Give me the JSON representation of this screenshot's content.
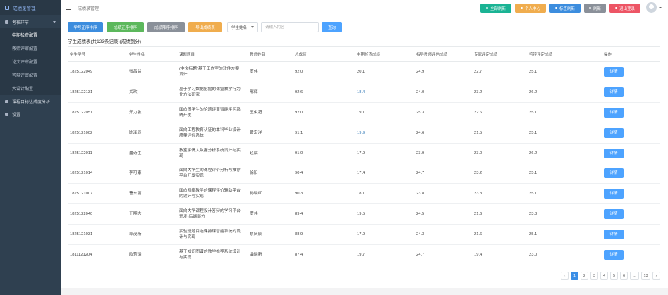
{
  "sidebar": {
    "brand": "成绩录管理",
    "items": [
      {
        "label": "考核环节",
        "expanded": true
      },
      {
        "label": "课程目标达成度分析"
      },
      {
        "label": "设置"
      }
    ],
    "subitems": [
      {
        "label": "中期检查配置",
        "active": true
      },
      {
        "label": "教师评审配置"
      },
      {
        "label": "论文评审配置"
      },
      {
        "label": "答辩评审配置"
      },
      {
        "label": "大设计配置"
      }
    ]
  },
  "topbar": {
    "breadcrumb": "成绩录管理",
    "buttons": [
      {
        "label": "全部刷新",
        "color": "#1ab394"
      },
      {
        "label": "个人中心",
        "color": "#f0ad4e"
      },
      {
        "label": "标签刷新",
        "color": "#3c8dde"
      },
      {
        "label": "刷新",
        "color": "#8a9099"
      },
      {
        "label": "退出登录",
        "color": "#ed5565"
      }
    ]
  },
  "toolbar": {
    "import_label": "学号正序排序",
    "btn2_label": "成绩正序排序",
    "btn3_label": "成绩降序排序",
    "export_label": "导出成绩表",
    "select_value": "学生姓名",
    "search_placeholder": "请输入内容",
    "search_label": "查询"
  },
  "summary": "学生成绩表(共123条记录)(成绩到分)",
  "table": {
    "headers": [
      "学生学号",
      "学生姓名",
      "课题题目",
      "教师姓名",
      "总成绩",
      "中期检查成绩",
      "指导教师评估成绩",
      "专家评定成绩",
      "答辩评定成绩",
      "操作"
    ],
    "action_label": "详情",
    "rows": [
      [
        "1825122049",
        "张昌铭",
        "(中文标题)基于工作室的软件方案设计",
        "罗伟",
        "92.0",
        "20.1",
        "24.9",
        "22.7",
        "25.1"
      ],
      [
        "1825122131",
        "关欢",
        "基于学习数据挖掘的课堂教学行为化方法研究",
        "邢辉",
        "92.6",
        "18.4",
        "24.0",
        "23.2",
        "26.2"
      ],
      [
        "1825122051",
        "郑力敏",
        "面向图学生的论题评审智能学习系统开发",
        "王俊超",
        "92.0",
        "19.1",
        "25.3",
        "22.6",
        "25.1"
      ],
      [
        "1825121002",
        "陈泽辰",
        "面向工程教育认证的本科毕业设计质量评价系统",
        "黄宏洋",
        "91.1",
        "19.9",
        "24.6",
        "21.5",
        "25.1"
      ],
      [
        "1825122011",
        "潘诗生",
        "教室学情大数据分析系统设计与实现",
        "赵斌",
        "91.0",
        "17.9",
        "23.9",
        "23.0",
        "26.2"
      ],
      [
        "1825121014",
        "李可康",
        "面向大学生的课程评价分析与推荐平台开发实现",
        "徐阳",
        "90.4",
        "17.4",
        "24.7",
        "23.2",
        "25.1"
      ],
      [
        "1825121007",
        "曹东丽",
        "面向网络教学的课程评价辅助平台的设计与实现",
        "孙晓红",
        "90.3",
        "18.1",
        "23.8",
        "23.3",
        "25.1"
      ],
      [
        "1825122040",
        "王翔志",
        "面向大学课程设计答辩的学习平台开发-后端部分",
        "罗伟",
        "89.4",
        "19.5",
        "24.5",
        "21.6",
        "23.8"
      ],
      [
        "1825121031",
        "郭茂杨",
        "实验班题目选课排课智能系统的设计与实现",
        "蔡庆辰",
        "88.9",
        "17.9",
        "24.3",
        "21.6",
        "25.1"
      ],
      [
        "1811121204",
        "欧芳瑞",
        "基于知识图谱的教学推荐系统设计与实现",
        "曲晓新",
        "87.4",
        "19.7",
        "24.7",
        "19.4",
        "23.0"
      ]
    ]
  },
  "pagination": {
    "prev": "‹",
    "pages": [
      "1",
      "2",
      "3",
      "4",
      "5",
      "6",
      "...",
      "13"
    ],
    "current": "1",
    "next": "›"
  },
  "icons": {
    "brand": "dashboard-icon",
    "menu": "hamburger-icon",
    "user": "avatar-icon"
  }
}
